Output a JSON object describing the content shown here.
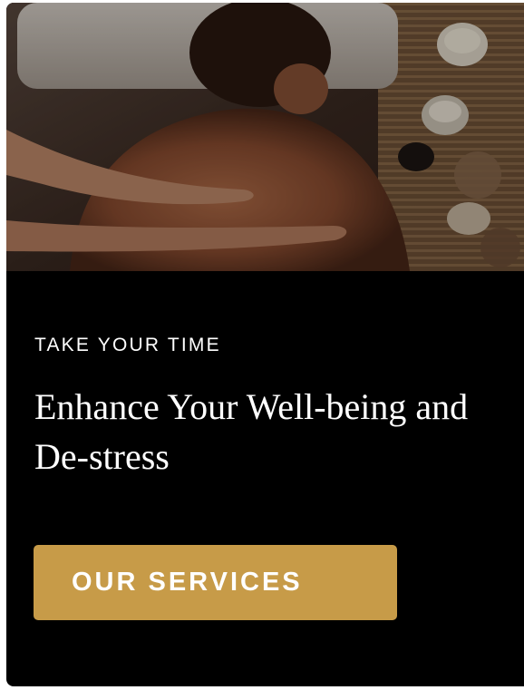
{
  "hero": {
    "image_icon": "spa-massage-photo"
  },
  "promo": {
    "eyebrow": "TAKE YOUR TIME",
    "headline": "Enhance Your Well-being and De-stress",
    "cta_label": "OUR SERVICES"
  },
  "colors": {
    "card_background": "#000000",
    "button_background": "#c79b48",
    "text": "#ffffff"
  }
}
